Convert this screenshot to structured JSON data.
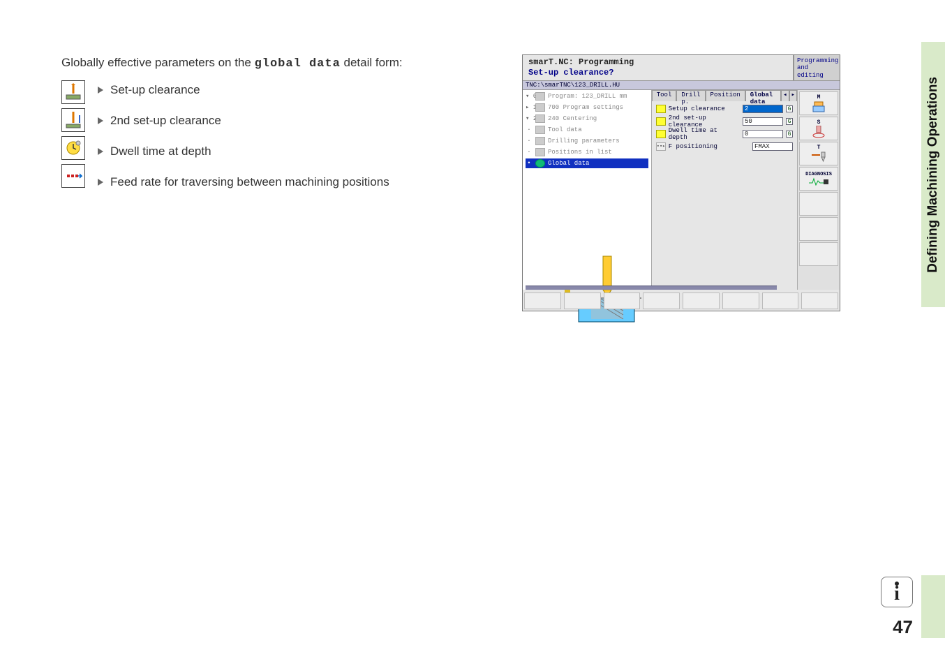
{
  "intro_prefix": "Globally effective parameters on the ",
  "intro_code": "global data",
  "intro_suffix": " detail form:",
  "bullets": {
    "b1": "Set-up clearance",
    "b2": "2nd set-up clearance",
    "b3": "Dwell time at depth",
    "b4": "Feed rate for traversing between machining positions"
  },
  "sidebar_title": "Defining Machining Operations",
  "page_number": "47",
  "info_glyph": "i",
  "shot": {
    "title_l1": "smarT.NC: Programming",
    "title_l2": "Set-up clearance?",
    "mode_l1": "Programming",
    "mode_l2": "and editing",
    "path": "TNC:\\smarTNC\\123_DRILL.HU",
    "tree": {
      "r0": "Program: 123_DRILL mm",
      "r1": "700 Program settings",
      "r2": "240 Centering",
      "r3": "Tool data",
      "r4": "Drilling parameters",
      "r5": "Positions in list",
      "r6": "Global data"
    },
    "tabs": {
      "t1": "Tool",
      "t2": "Drill p.",
      "t3": "Position",
      "t4": "Global data"
    },
    "form": {
      "f1": "Setup clearance",
      "v1": "2",
      "f2": "2nd set-up clearance",
      "v2": "50",
      "f3": "Dwell time at depth",
      "v3": "0",
      "f4": "F positioning",
      "v4": "FMAX"
    },
    "g": "G",
    "side": {
      "m": "M",
      "s": "S",
      "t": "T",
      "diag": "DIAGNOSIS"
    }
  }
}
